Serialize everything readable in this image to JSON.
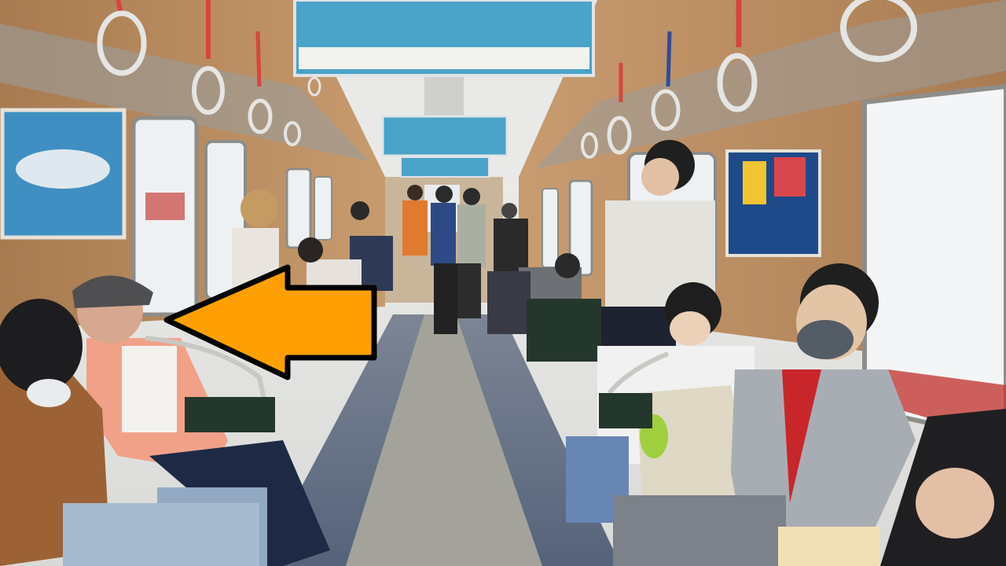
{
  "scene": {
    "description_type": "photo",
    "overlay": {
      "arrow": {
        "direction": "left",
        "color": "#ffa000",
        "outline_color": "#000000"
      }
    },
    "colors": {
      "wall_panel": "#b8895e",
      "floor_blue": "#5f6f86",
      "floor_center": "#9c9b93",
      "window_light": "#eef2f5",
      "ceiling": "#e7e8e6",
      "ad_banner": "#4aa3c8",
      "seat_green": "#24372c",
      "strap": "#d8453e"
    }
  }
}
